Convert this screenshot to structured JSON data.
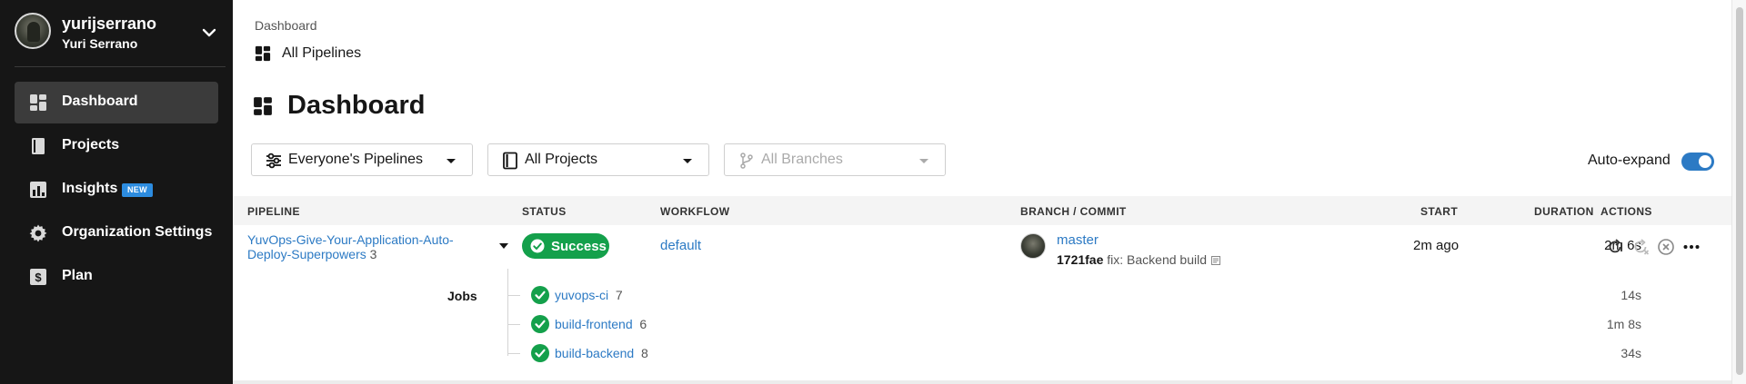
{
  "user": {
    "username": "yurijserrano",
    "full_name": "Yuri Serrano"
  },
  "sidebar": {
    "items": [
      {
        "label": "Dashboard",
        "icon": "dashboard-icon",
        "active": true
      },
      {
        "label": "Projects",
        "icon": "book-icon",
        "active": false
      },
      {
        "label": "Insights",
        "icon": "insights-icon",
        "active": false,
        "badge": "NEW"
      },
      {
        "label": "Organization Settings",
        "icon": "gear-icon",
        "active": false
      },
      {
        "label": "Plan",
        "icon": "dollar-icon",
        "active": false
      }
    ]
  },
  "breadcrumb": {
    "root": "Dashboard",
    "current": "All Pipelines"
  },
  "page": {
    "title": "Dashboard"
  },
  "filters": {
    "pipelines": "Everyone's Pipelines",
    "projects": "All Projects",
    "branches": "All Branches"
  },
  "auto_expand": {
    "label": "Auto-expand",
    "enabled": true
  },
  "table": {
    "headers": {
      "pipeline": "PIPELINE",
      "status": "STATUS",
      "workflow": "WORKFLOW",
      "branch_commit": "BRANCH / COMMIT",
      "start": "START",
      "duration": "DURATION",
      "actions": "ACTIONS"
    },
    "row": {
      "pipeline_name_line1": "YuvOps-Give-Your-Application-Auto-",
      "pipeline_name_line2": "Deploy-Superpowers",
      "pipeline_number": "3",
      "status": "Success",
      "workflow": "default",
      "branch": "master",
      "commit_hash": "1721fae",
      "commit_message": "fix: Backend build",
      "start": "2m ago",
      "duration": "2m 6s"
    },
    "jobs_label": "Jobs",
    "jobs": [
      {
        "name": "yuvops-ci",
        "number": "7",
        "duration": "14s"
      },
      {
        "name": "build-frontend",
        "number": "6",
        "duration": "1m 8s"
      },
      {
        "name": "build-backend",
        "number": "8",
        "duration": "34s"
      }
    ]
  },
  "colors": {
    "sidebar_bg": "#161616",
    "accent_blue": "#2c7ac4",
    "success_green": "#14a04b",
    "badge_blue": "#2c8ce0"
  }
}
